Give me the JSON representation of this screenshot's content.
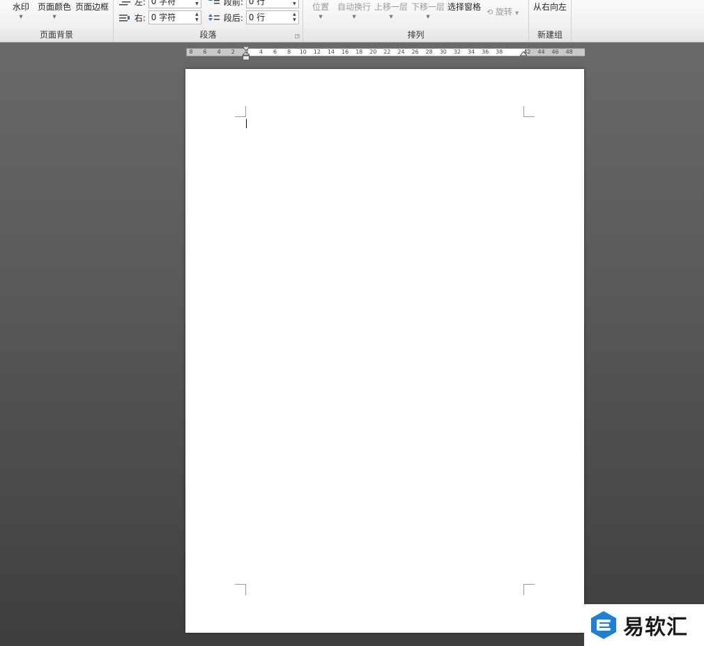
{
  "ribbon": {
    "page_background": {
      "label": "页面背景",
      "watermark": "水印",
      "page_color": "页面颜色",
      "page_border": "页面边框"
    },
    "paragraph": {
      "label": "段落",
      "indent_left_label": "左:",
      "indent_left_value": "0 字符",
      "indent_right_label": "右:",
      "indent_right_value": "0 字符",
      "spacing_before_label": "段前:",
      "spacing_before_value": "0 行",
      "spacing_after_label": "段后:",
      "spacing_after_value": "0 行"
    },
    "arrange": {
      "label": "排列",
      "position": "位置",
      "wrap_text": "自动换行",
      "bring_forward": "上移一层",
      "send_backward": "下移一层",
      "selection_pane": "选择窗格",
      "rotate": "旋转"
    },
    "new_group": {
      "label": "新建组",
      "rtl": "从右向左"
    }
  },
  "ruler": {
    "labels": [
      "8",
      "6",
      "4",
      "2",
      "2",
      "4",
      "6",
      "8",
      "10",
      "12",
      "14",
      "16",
      "18",
      "20",
      "22",
      "24",
      "26",
      "28",
      "30",
      "32",
      "34",
      "36",
      "38",
      "42",
      "44",
      "46",
      "48"
    ]
  },
  "watermark_logo": {
    "text": "易软汇"
  },
  "colors": {
    "logo_blue": "#1e7fd8",
    "workspace": "#5a5a5a"
  }
}
